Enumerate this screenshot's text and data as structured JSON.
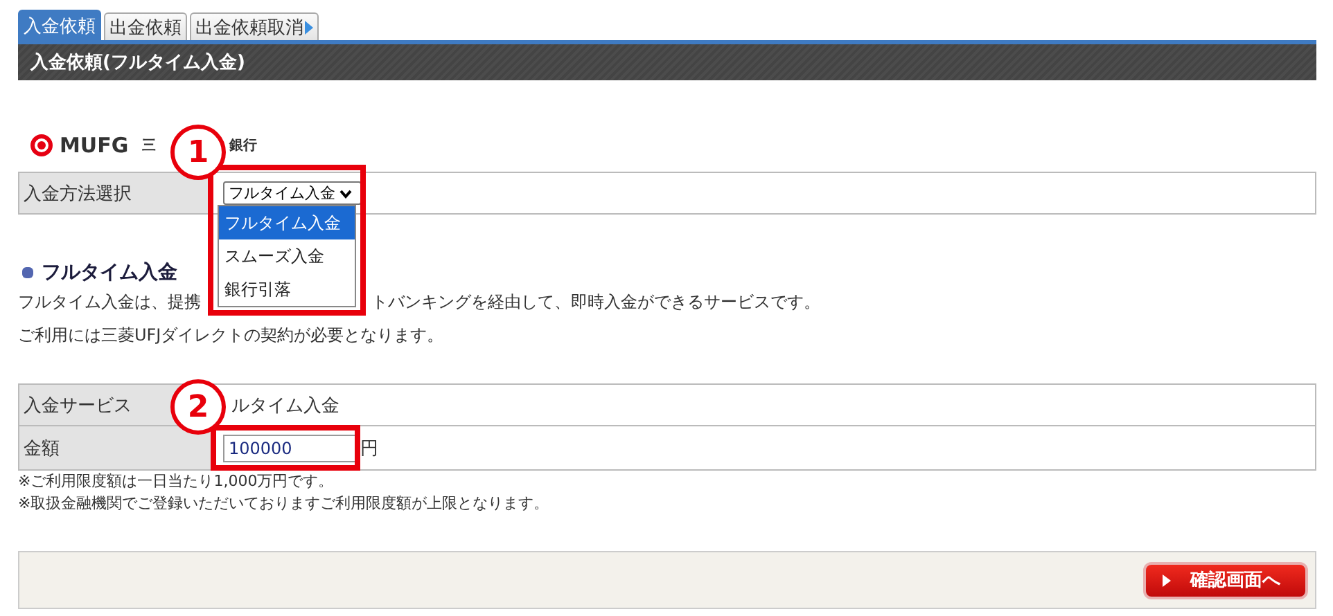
{
  "tabs": [
    {
      "label": "入金依頼",
      "selected": true
    },
    {
      "label": "出金依頼",
      "selected": false
    },
    {
      "label": "出金依頼取消",
      "selected": false
    }
  ],
  "section_title": "入金依頼(フルタイム入金)",
  "bank_logo": {
    "mark": "MUFG",
    "name_parts": [
      "三",
      "銀行"
    ]
  },
  "method_row": {
    "label": "入金方法選択",
    "select_value": "フルタイム入金",
    "options": [
      {
        "label": "フルタイム入金",
        "selected": true
      },
      {
        "label": "スムーズ入金",
        "selected": false
      },
      {
        "label": "銀行引落",
        "selected": false
      }
    ]
  },
  "info": {
    "heading": "フルタイム入金",
    "line_1_parts": [
      "フルタイム入金は、提携",
      "トバンキングを経由して、即時入金ができるサービスです。"
    ],
    "line_2": "ご利用には三菱UFJダイレクトの契約が必要となります。"
  },
  "form_rows": [
    {
      "kind": "text",
      "label": "入金サービス",
      "value": "ルタイム入金"
    },
    {
      "kind": "input",
      "label": "金額",
      "value": "100000",
      "unit": "円"
    }
  ],
  "notes": [
    "※ご利用限度額は一日当たり1,000万円です。",
    "※取扱金融機関でご登録いただいておりますご利用限度額が上限となります。"
  ],
  "submit_button": "確認画面へ",
  "callouts": [
    {
      "number": "1"
    },
    {
      "number": "2"
    }
  ]
}
